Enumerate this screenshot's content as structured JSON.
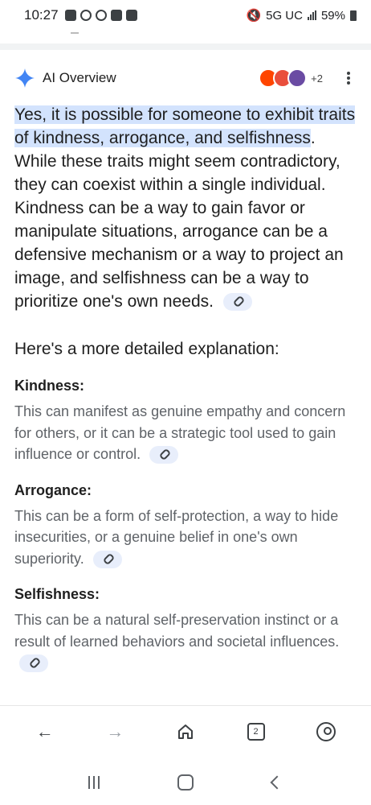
{
  "status": {
    "time": "10:27",
    "network": "5G UC",
    "battery": "59%"
  },
  "overview": {
    "title": "AI Overview",
    "extra_sources": "+2",
    "lead_highlight": "Yes, it is possible for someone to exhibit traits of kindness, arrogance, and selfishness",
    "lead_rest": ". While these traits might seem contradictory, they can coexist within a single individual. Kindness can be a way to gain favor or manipulate situations, arrogance can be a defensive mechanism or a way to project an image, and selfishness can be a way to prioritize one's own needs.",
    "subheading": "Here's a more detailed explanation:",
    "items": [
      {
        "term": "Kindness:",
        "desc": "This can manifest as genuine empathy and concern for others, or it can be a strategic tool used to gain influence or control."
      },
      {
        "term": "Arrogance:",
        "desc": "This can be a form of self-protection, a way to hide insecurities, or a genuine belief in one's own superiority."
      },
      {
        "term": "Selfishness:",
        "desc": "This can be a natural self-preservation instinct or a result of learned behaviors and societal influences."
      }
    ]
  },
  "bottom_nav": {
    "tab_count": "2"
  }
}
